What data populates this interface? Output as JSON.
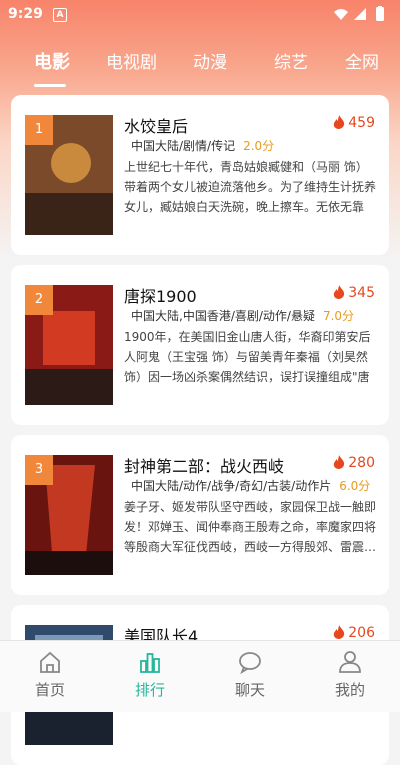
{
  "status": {
    "time": "9:29",
    "indicator": "A"
  },
  "tabs": [
    "电影",
    "电视剧",
    "动漫",
    "综艺",
    "全网"
  ],
  "movies": [
    {
      "rank": "1",
      "title": "水饺皇后",
      "hot": "459",
      "genre": "中国大陆/剧情/传记",
      "score": "2.0分",
      "desc": "上世纪七十年代，青岛姑娘臧健和（马丽 饰）带着两个女儿被迫流落他乡。为了维持生计抚养女儿，臧姑娘白天洗碗，晚上擦车。无依无靠的…",
      "poster_colors": [
        "#7b4a2a",
        "#c98a3e",
        "#3a2418"
      ]
    },
    {
      "rank": "2",
      "title": "唐探1900",
      "hot": "345",
      "genre": "中国大陆,中国香港/喜剧/动作/悬疑",
      "score": "7.0分",
      "desc": "1900年，在美国旧金山唐人街，华裔印第安后人阿鬼（王宝强 饰）与留美青年秦福（刘昊然 饰）因一场凶杀案偶然结识，误打误撞组成\"唐人街…",
      "poster_colors": [
        "#8a1a16",
        "#d23a22",
        "#2c1a16"
      ]
    },
    {
      "rank": "3",
      "title": "封神第二部：战火西岐",
      "hot": "280",
      "genre": "中国大陆/动作/战争/奇幻/古装/动作片",
      "score": "6.0分",
      "desc": "姜子牙、姬发带队坚守西岐，家园保卫战一触即发！邓婵玉、闻仲奉商王殷寿之命，率魔家四将等殷商大军征伐西岐，西岐一方得殷郊、雷震…",
      "poster_colors": [
        "#6a1410",
        "#c23820",
        "#1c0e0c"
      ]
    },
    {
      "rank": "4",
      "title": "美国队长4",
      "hot": "206",
      "genre": "",
      "score": "",
      "desc": "",
      "poster_colors": [
        "#2f4a6a",
        "#7a98b8",
        "#1a2230"
      ]
    }
  ],
  "bottom_nav": [
    {
      "label": "首页",
      "icon": "home-icon",
      "active": false
    },
    {
      "label": "排行",
      "icon": "ranking-icon",
      "active": true
    },
    {
      "label": "聊天",
      "icon": "chat-icon",
      "active": false
    },
    {
      "label": "我的",
      "icon": "profile-icon",
      "active": false
    }
  ],
  "colors": {
    "accent": "#26b79a",
    "hot": "#e5481f",
    "score": "#e79b1c",
    "rank_badge": "#f0873a",
    "header": "#f7836a"
  }
}
